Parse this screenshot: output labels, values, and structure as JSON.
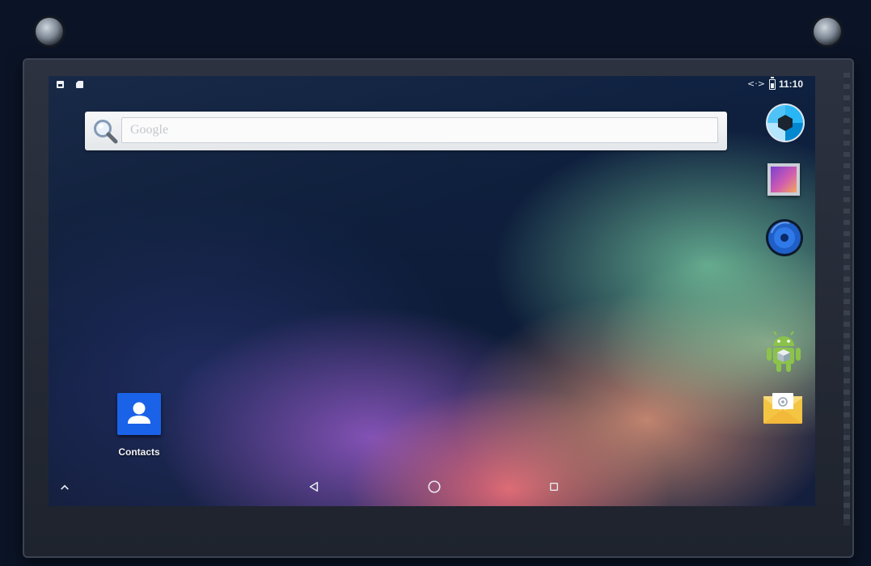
{
  "status_bar": {
    "time": "11:10",
    "sync_glyph": "<·>",
    "icons": [
      "photo-notification-icon",
      "sd-card-icon",
      "sync-icon",
      "battery-icon"
    ]
  },
  "search": {
    "placeholder": "Google",
    "value": "",
    "icon": "magnifier-icon"
  },
  "dock": {
    "apps": [
      {
        "icon": "camera-icon"
      },
      {
        "icon": "gallery-icon"
      },
      {
        "icon": "music-icon"
      },
      {
        "icon": "android-icon"
      },
      {
        "icon": "email-icon"
      }
    ]
  },
  "home": {
    "shortcuts": [
      {
        "label": "Contacts",
        "icon": "contacts-icon",
        "color": "#1a62e8"
      }
    ]
  },
  "nav_bar": {
    "buttons": [
      "chevron-up-icon",
      "back-icon",
      "home-icon",
      "recents-icon"
    ]
  },
  "colors": {
    "wallpaper_base": "#0f2140",
    "search_bar": "#eef0f2",
    "contacts_blue": "#1a62e8"
  }
}
